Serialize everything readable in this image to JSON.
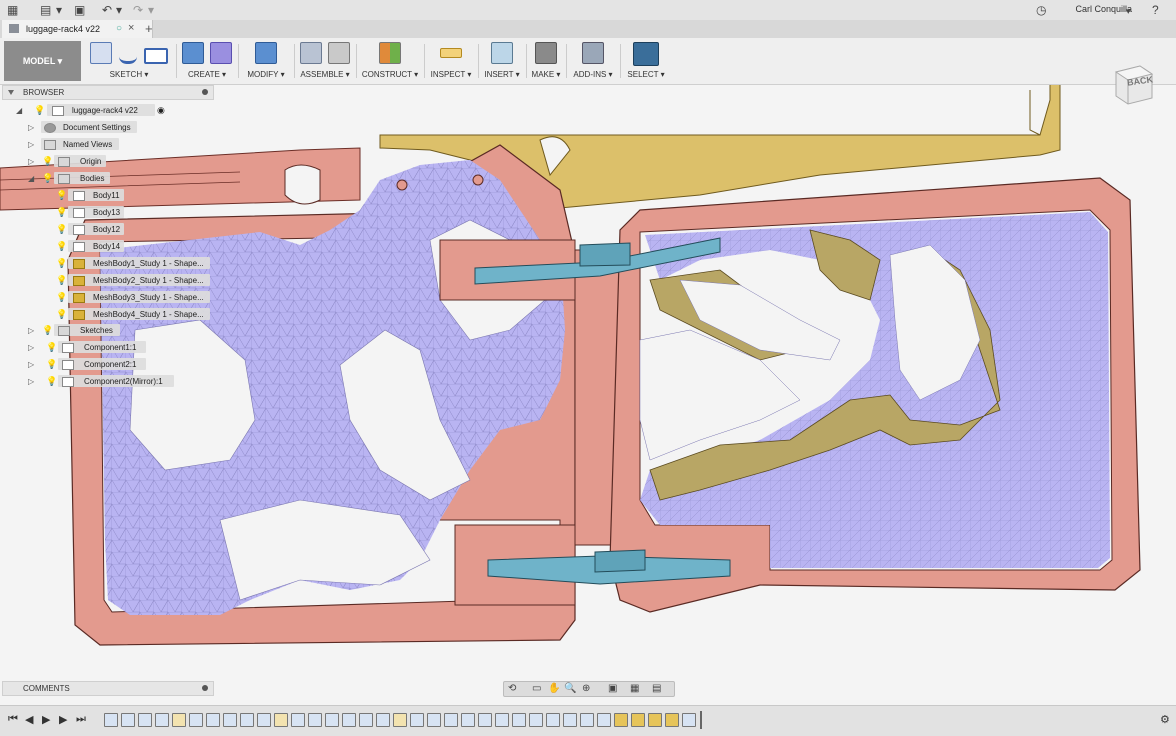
{
  "window": {
    "user": "Carl Conquilla"
  },
  "tab": {
    "title": "luggage-rack4 v22"
  },
  "toolbar": {
    "workspace": "MODEL",
    "groups": [
      {
        "label": "SKETCH ▾",
        "icons": [
          "sketch-icon",
          "line-icon",
          "rectangle-icon"
        ]
      },
      {
        "label": "CREATE ▾",
        "icons": [
          "box-icon",
          "mesh-icon"
        ]
      },
      {
        "label": "MODIFY ▾",
        "icons": [
          "press-pull-icon"
        ]
      },
      {
        "label": "ASSEMBLE ▾",
        "icons": [
          "component-icon",
          "joint-icon"
        ]
      },
      {
        "label": "CONSTRUCT ▾",
        "icons": [
          "plane-icon"
        ]
      },
      {
        "label": "INSPECT ▾",
        "icons": [
          "measure-icon"
        ]
      },
      {
        "label": "INSERT ▾",
        "icons": [
          "insert-image-icon"
        ]
      },
      {
        "label": "MAKE ▾",
        "icons": [
          "print-icon"
        ]
      },
      {
        "label": "ADD-INS ▾",
        "icons": [
          "scripts-icon"
        ]
      },
      {
        "label": "SELECT ▾",
        "icons": [
          "select-icon"
        ]
      }
    ]
  },
  "browser": {
    "title": "BROWSER",
    "root": "luggage-rack4 v22",
    "items": [
      {
        "label": "Document Settings",
        "icon": "gear-icon"
      },
      {
        "label": "Named Views",
        "icon": "folder-icon"
      },
      {
        "label": "Origin",
        "icon": "folder-icon"
      },
      {
        "label": "Bodies",
        "icon": "folder-icon"
      },
      {
        "label": "Body11",
        "icon": "body-icon"
      },
      {
        "label": "Body13",
        "icon": "body-icon"
      },
      {
        "label": "Body12",
        "icon": "body-icon"
      },
      {
        "label": "Body14",
        "icon": "body-icon"
      },
      {
        "label": "MeshBody1_Study 1 - Shape...",
        "icon": "mesh-icon"
      },
      {
        "label": "MeshBody2_Study 1 - Shape...",
        "icon": "mesh-icon"
      },
      {
        "label": "MeshBody3_Study 1 - Shape...",
        "icon": "mesh-icon"
      },
      {
        "label": "MeshBody4_Study 1 - Shape...",
        "icon": "mesh-icon"
      },
      {
        "label": "Sketches",
        "icon": "folder-icon"
      },
      {
        "label": "Component1:1",
        "icon": "component-icon"
      },
      {
        "label": "Component2:1",
        "icon": "component-icon"
      },
      {
        "label": "Component2(Mirror):1",
        "icon": "component-icon"
      }
    ]
  },
  "comments": {
    "title": "COMMENTS"
  },
  "viewcube": {
    "face": "BACK"
  },
  "colors": {
    "frame": "#e39a8e",
    "mesh": "#b9b4f2",
    "gold": "#dcc06a",
    "olive": "#b8a665",
    "cyan": "#6fb3c9"
  }
}
